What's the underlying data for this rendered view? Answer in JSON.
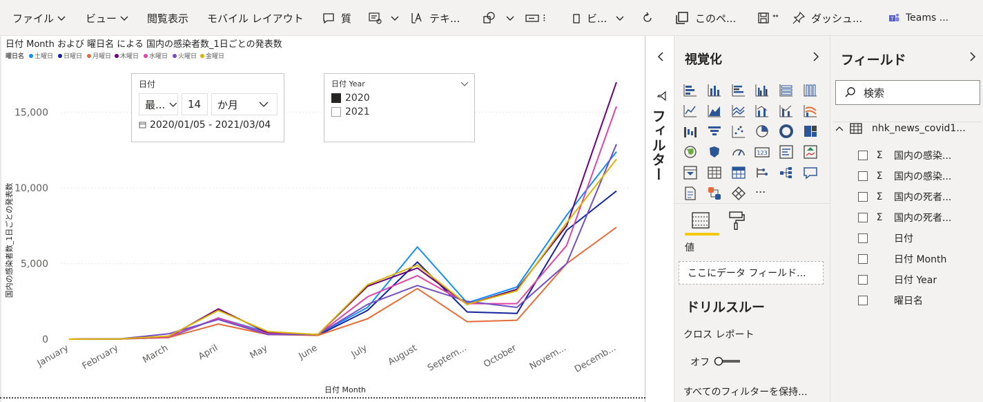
{
  "toolbar": {
    "file": "ファイル",
    "view": "ビュー",
    "reading_view": "閲覧表示",
    "mobile_layout": "モバイル レイアウト",
    "qa": "質",
    "text": "テキ...",
    "visual": "ビ...",
    "this_page": "このペ...",
    "dashboard": "ダッシュ...",
    "teams": "Teams ..."
  },
  "chart": {
    "title": "日付 Month および 曜日名 による 国内の感染者数_1日ごとの発表数",
    "legend_title": "曜日名",
    "xlabel": "日付 Month",
    "ylabel": "国内の感染者数_1日ごとの発表数"
  },
  "chart_data": {
    "type": "line",
    "categories": [
      "January",
      "February",
      "March",
      "April",
      "May",
      "June",
      "July",
      "August",
      "Septem...",
      "October",
      "Novem...",
      "Decemb..."
    ],
    "ylim": [
      0,
      17500
    ],
    "yticks": [
      0,
      5000,
      10000,
      15000
    ],
    "ytick_labels": [
      "0",
      "5,000",
      "10,000",
      "15,000"
    ],
    "grid": true,
    "legend_position": "top-left",
    "series": [
      {
        "name": "土曜日",
        "color": "#118DFF",
        "values": [
          0,
          10,
          100,
          1400,
          450,
          300,
          2100,
          6100,
          2400,
          3450,
          8200,
          12400
        ]
      },
      {
        "name": "日曜日",
        "color": "#12239E",
        "values": [
          0,
          10,
          150,
          1400,
          350,
          250,
          1900,
          5100,
          1800,
          1700,
          7200,
          9800
        ]
      },
      {
        "name": "月曜日",
        "color": "#E66C37",
        "values": [
          0,
          10,
          100,
          1000,
          300,
          250,
          1350,
          3350,
          1150,
          1250,
          5000,
          7400
        ]
      },
      {
        "name": "木曜日",
        "color": "#6B007B",
        "values": [
          0,
          10,
          150,
          2000,
          400,
          300,
          3500,
          4700,
          2300,
          3300,
          7500,
          17000
        ]
      },
      {
        "name": "水曜日",
        "color": "#E044A7",
        "values": [
          0,
          10,
          150,
          1400,
          350,
          300,
          2800,
          4200,
          2350,
          2350,
          6200,
          15400
        ]
      },
      {
        "name": "火曜日",
        "color": "#744EC2",
        "values": [
          0,
          10,
          350,
          1300,
          300,
          300,
          2300,
          3550,
          2500,
          2100,
          5000,
          12900
        ]
      },
      {
        "name": "金曜日",
        "color": "#D9B300",
        "values": [
          0,
          10,
          200,
          1900,
          500,
          300,
          3600,
          4900,
          2300,
          3200,
          7700,
          11900
        ]
      }
    ]
  },
  "date_slicer": {
    "title": "日付",
    "mode": "最...",
    "count": "14",
    "unit": "か月",
    "range": "2020/01/05 - 2021/03/04"
  },
  "year_slicer": {
    "title": "日付 Year",
    "options": [
      {
        "label": "2020",
        "checked": true
      },
      {
        "label": "2021",
        "checked": false
      }
    ]
  },
  "filters": {
    "label": "フィルター"
  },
  "visualizations": {
    "title": "視覚化",
    "more": "...",
    "value_label": "値",
    "drop_placeholder": "ここにデータ フィールド...",
    "drillthrough_title": "ドリルスルー",
    "cross_report": "クロス レポート",
    "toggle_off": "オフ",
    "keep_all_filters": "すべてのフィルターを保持..."
  },
  "fields": {
    "title": "フィールド",
    "search_placeholder": "検索",
    "table_name": "nhk_news_covid1...",
    "items": [
      {
        "label": "国内の感染...",
        "sigma": "Σ"
      },
      {
        "label": "国内の感染...",
        "sigma": "Σ"
      },
      {
        "label": "国内の死者...",
        "sigma": "Σ"
      },
      {
        "label": "国内の死者...",
        "sigma": "Σ"
      },
      {
        "label": "日付",
        "sigma": ""
      },
      {
        "label": "日付 Month",
        "sigma": ""
      },
      {
        "label": "日付 Year",
        "sigma": ""
      },
      {
        "label": "曜日名",
        "sigma": ""
      }
    ]
  },
  "colors": {
    "accent": "#F2C811",
    "pane_bg": "#F3F2F1",
    "icon_blue": "#2B579A"
  }
}
